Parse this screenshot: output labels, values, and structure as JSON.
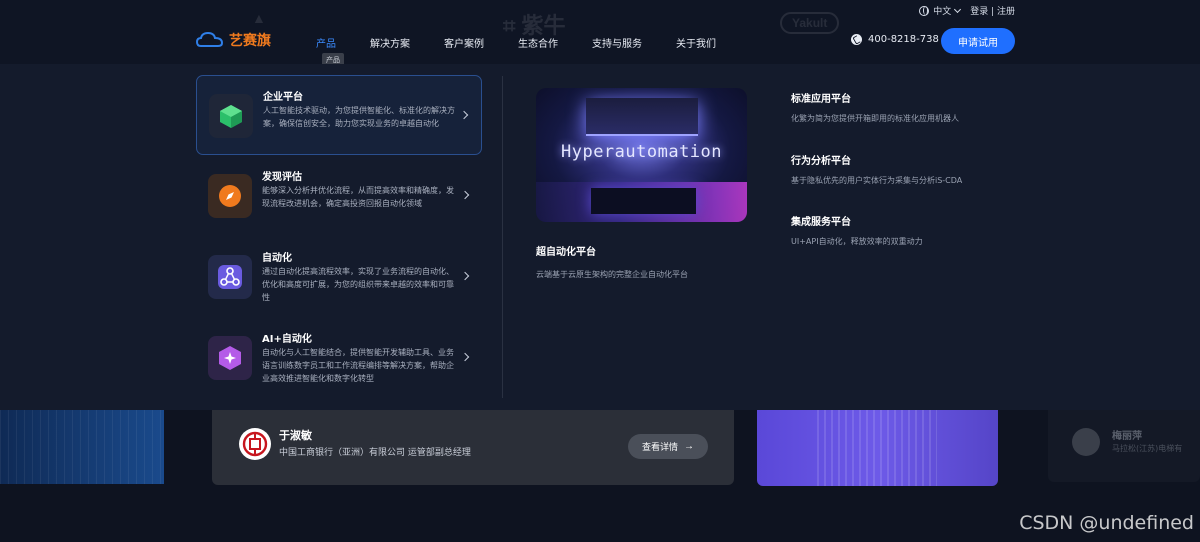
{
  "background_logos": [
    "▲",
    "⌗ 紫牛",
    "Yakult"
  ],
  "utility": {
    "language": "中文",
    "auth": "登录 | 注册"
  },
  "brand": {
    "name": "艺赛旗",
    "color": "#f07a1e"
  },
  "nav": {
    "items": [
      {
        "label": "产品",
        "active": true
      },
      {
        "label": "解决方案",
        "active": false
      },
      {
        "label": "客户案例",
        "active": false
      },
      {
        "label": "生态合作",
        "active": false
      },
      {
        "label": "支持与服务",
        "active": false
      },
      {
        "label": "关于我们",
        "active": false
      }
    ],
    "tooltip": "产品"
  },
  "contact": {
    "phone": "400-8218-738"
  },
  "cta": {
    "label": "申请试用",
    "color": "#1f6fff"
  },
  "menu": [
    {
      "title": "企业平台",
      "desc": "人工智能技术驱动，为您提供智能化、标准化的解决方案，确保信创安全，助力您实现业务的卓越自动化",
      "icon": "cube-icon",
      "selected": true
    },
    {
      "title": "发现评估",
      "desc": "能够深入分析并优化流程，从而提高效率和精确度，发现流程改进机会，确定高投资回报自动化领域",
      "icon": "compass-icon",
      "selected": false
    },
    {
      "title": "自动化",
      "desc": "通过自动化提高流程效率，实现了业务流程的自动化、优化和高度可扩展，为您的组织带来卓越的效率和可靠性",
      "icon": "workflow-icon",
      "selected": false
    },
    {
      "title": "AI+自动化",
      "desc": "自动化与人工智能结合，提供智能开发辅助工具、业务语言训练数字员工和工作流程编排等解决方案，帮助企业高效推进智能化和数字化转型",
      "icon": "sparkle-icon",
      "selected": false
    }
  ],
  "featured": {
    "image_text": "Hyperautomation",
    "title": "超自动化平台",
    "desc": "云端基于云原生架构的完整企业自动化平台"
  },
  "platforms": [
    {
      "title": "标准应用平台",
      "desc": "化繁为简为您提供开箱即用的标准化应用机器人"
    },
    {
      "title": "行为分析平台",
      "desc": "基于隐私优先的用户实体行为采集与分析iS-CDA"
    },
    {
      "title": "集成服务平台",
      "desc": "UI+API自动化，释放效率的双重动力"
    }
  ],
  "testimonial": {
    "name": "于淑敏",
    "role": "中国工商银行（亚洲）有限公司 运管部副总经理",
    "button": "查看详情",
    "button_arrow": "→"
  },
  "ghost_card": {
    "name": "梅丽萍",
    "role": "马拉松(江苏)电梯有"
  },
  "watermark": "CSDN @undefined"
}
